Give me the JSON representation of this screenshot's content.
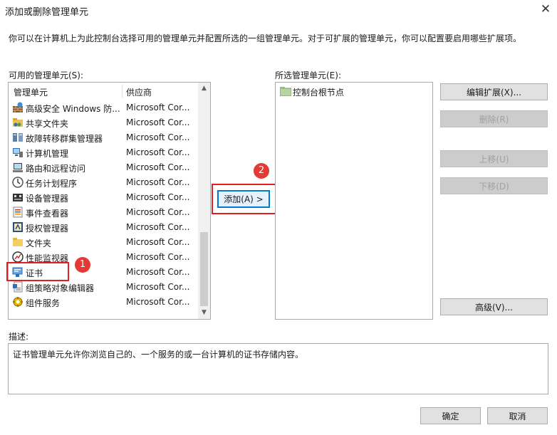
{
  "window": {
    "title": "添加或删除管理单元",
    "close_glyph": "✕"
  },
  "intro_text": "你可以在计算机上为此控制台选择可用的管理单元并配置所选的一组管理单元。对于可扩展的管理单元，你可以配置要启用哪些扩展项。",
  "available": {
    "label": "可用的管理单元(S):",
    "columns": [
      "管理单元",
      "供应商"
    ],
    "items": [
      {
        "name": "高级安全 Windows 防...",
        "vendor": "Microsoft Cor...",
        "icon": "firewall-icon"
      },
      {
        "name": "共享文件夹",
        "vendor": "Microsoft Cor...",
        "icon": "shared-folder-icon"
      },
      {
        "name": "故障转移群集管理器",
        "vendor": "Microsoft Cor...",
        "icon": "cluster-icon"
      },
      {
        "name": "计算机管理",
        "vendor": "Microsoft Cor...",
        "icon": "computer-management-icon"
      },
      {
        "name": "路由和远程访问",
        "vendor": "Microsoft Cor...",
        "icon": "routing-icon"
      },
      {
        "name": "任务计划程序",
        "vendor": "Microsoft Cor...",
        "icon": "clock-icon"
      },
      {
        "name": "设备管理器",
        "vendor": "Microsoft Cor...",
        "icon": "device-manager-icon"
      },
      {
        "name": "事件查看器",
        "vendor": "Microsoft Cor...",
        "icon": "event-viewer-icon"
      },
      {
        "name": "授权管理器",
        "vendor": "Microsoft Cor...",
        "icon": "authorization-icon"
      },
      {
        "name": "文件夹",
        "vendor": "Microsoft Cor...",
        "icon": "folder-icon"
      },
      {
        "name": "性能监视器",
        "vendor": "Microsoft Cor...",
        "icon": "performance-icon"
      },
      {
        "name": "证书",
        "vendor": "Microsoft Cor...",
        "icon": "certificate-icon"
      },
      {
        "name": "组策略对象编辑器",
        "vendor": "Microsoft Cor...",
        "icon": "group-policy-icon"
      },
      {
        "name": "组件服务",
        "vendor": "Microsoft Cor...",
        "icon": "component-services-icon"
      }
    ]
  },
  "selected": {
    "label": "所选管理单元(E):",
    "items": [
      {
        "name": "控制台根节点",
        "icon": "folder-icon"
      }
    ]
  },
  "buttons": {
    "add": "添加(A) >",
    "edit_extensions": "编辑扩展(X)...",
    "remove": "删除(R)",
    "move_up": "上移(U)",
    "move_down": "下移(D)",
    "advanced": "高级(V)...",
    "ok": "确定",
    "cancel": "取消"
  },
  "annotations": {
    "badge1": "1",
    "badge2": "2"
  },
  "description": {
    "label": "描述:",
    "text": "证书管理单元允许你浏览自己的、一个服务的或一台计算机的证书存储内容。"
  },
  "colors": {
    "accent": "#0078d7",
    "highlight_red": "#e02020",
    "badge_red": "#e53935"
  }
}
